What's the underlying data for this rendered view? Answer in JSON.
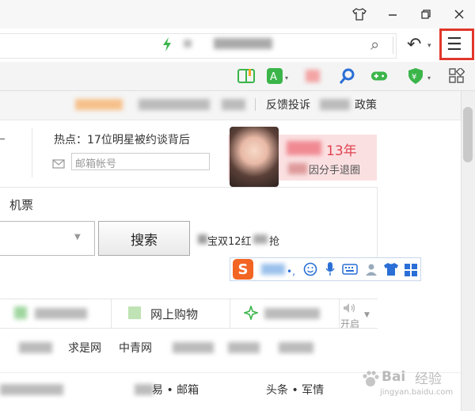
{
  "titlebar": {
    "buttons": [
      {
        "name": "skin-icon",
        "glyph": "👕"
      },
      {
        "name": "minimize-icon",
        "glyph": "—"
      },
      {
        "name": "restore-icon",
        "glyph": "❐"
      },
      {
        "name": "close-icon",
        "glyph": "✕"
      }
    ]
  },
  "toolbar": {
    "search_glyph": "⌕",
    "undo_glyph": "↶",
    "menu_glyph": "☰"
  },
  "extensions": {
    "translate_label": "A"
  },
  "nav": {
    "feedback": "反馈投诉",
    "policy": "政策"
  },
  "news": {
    "hot_topic": "热点：17位明星被约谈背后",
    "email_placeholder": "邮箱帐号",
    "ad_title_part": "13年",
    "ad_sub_part": "因分手退圈"
  },
  "search": {
    "tab_label": "机票",
    "button_label": "搜索",
    "promo_part": "宝双12红",
    "promo_end": "抢"
  },
  "sites": {
    "shopping": "网上购物",
    "open_label": "开启",
    "links": [
      "求是网",
      "中青网"
    ],
    "bottom": [
      "易 • 邮箱",
      "头条 • 军情"
    ]
  },
  "watermark": {
    "brand": "Bai",
    "text": "经验",
    "url": "jingyan.baidu.com"
  },
  "colors": {
    "accent_green": "#3bb54a",
    "highlight_red": "#e1362b",
    "ime_orange": "#f26522",
    "ime_blue": "#2a6fd6"
  }
}
